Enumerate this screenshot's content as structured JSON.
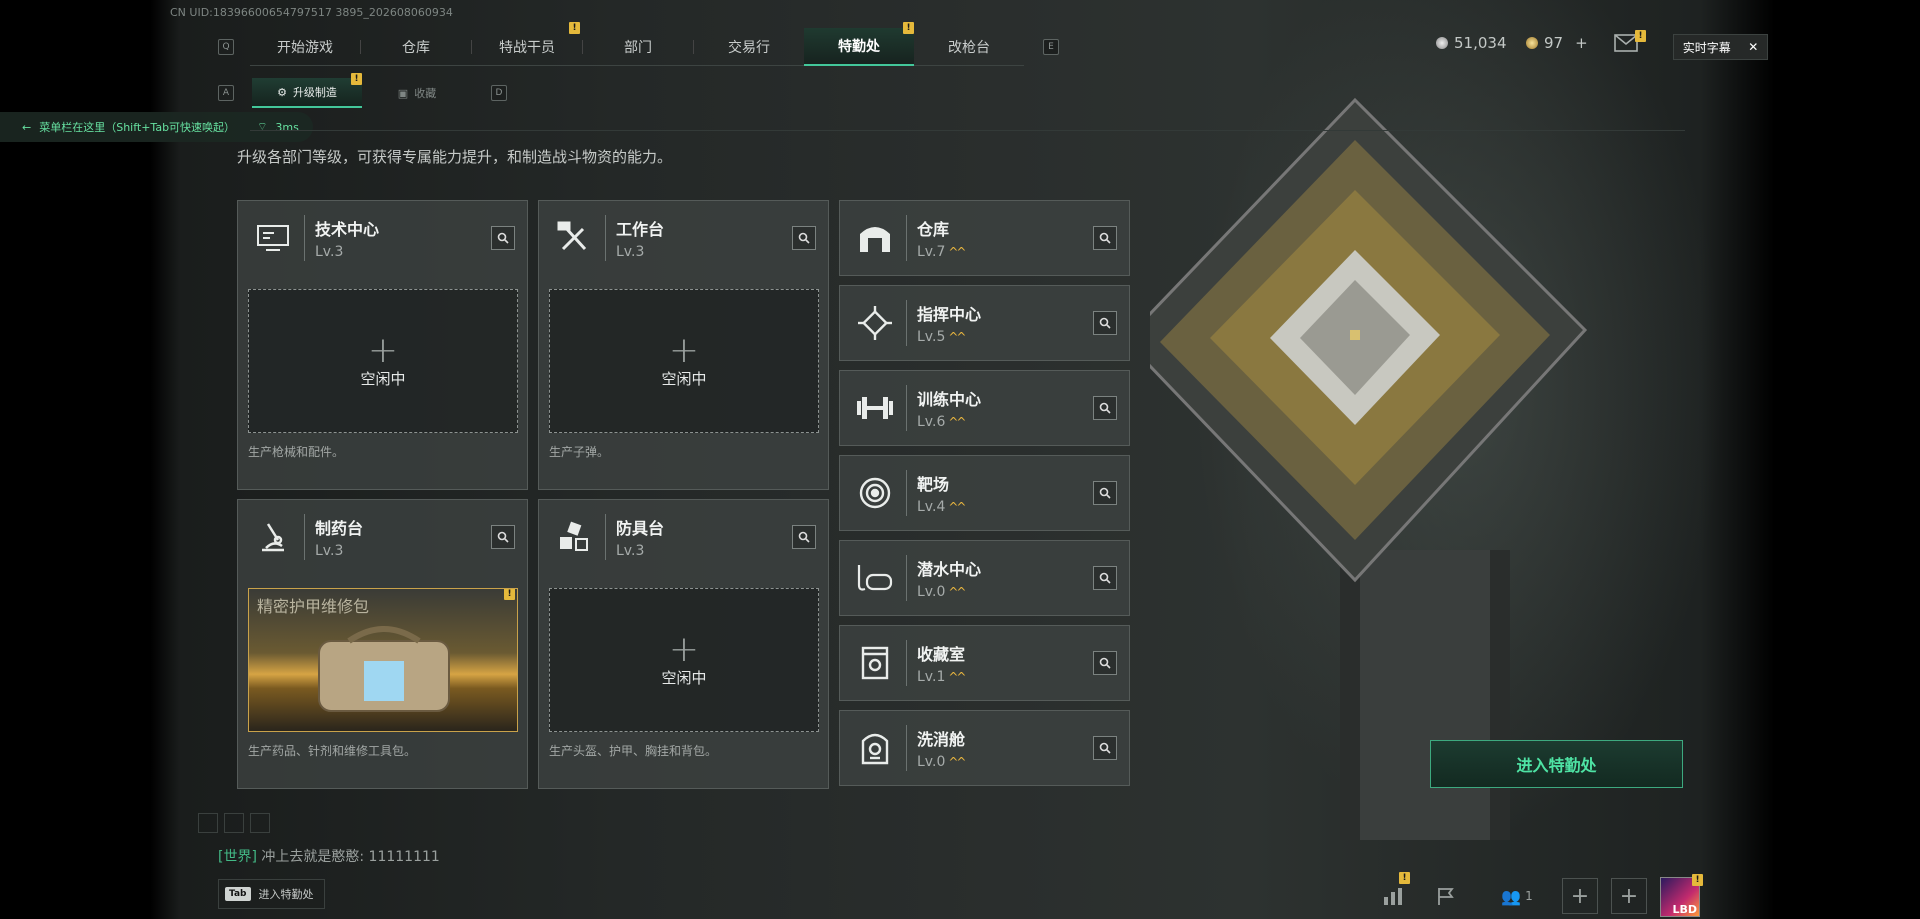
{
  "uid": "CN UID:18396600654797517 3895_202608060934",
  "nav": {
    "left_key": "Q",
    "right_key": "E",
    "tabs": [
      {
        "label": "开始游戏",
        "active": false,
        "badge": ""
      },
      {
        "label": "仓库",
        "active": false,
        "badge": ""
      },
      {
        "label": "特战干员",
        "active": false,
        "badge": "!"
      },
      {
        "label": "部门",
        "active": false,
        "badge": ""
      },
      {
        "label": "交易行",
        "active": false,
        "badge": ""
      },
      {
        "label": "特勤处",
        "active": true,
        "badge": "!"
      },
      {
        "label": "改枪台",
        "active": false,
        "badge": ""
      }
    ]
  },
  "subnav": {
    "left_key": "A",
    "right_key": "D",
    "tabs": [
      {
        "label": "升级制造",
        "active": true,
        "badge": "!"
      },
      {
        "label": "收藏",
        "active": false,
        "badge": ""
      }
    ]
  },
  "hint": {
    "text": "菜单栏在这里（Shift+Tab可快速唤起）",
    "ping": "3ms"
  },
  "description": "升级各部门等级，可获得专属能力提升，和制造战斗物资的能力。",
  "production": [
    {
      "name": "技术中心",
      "level": "Lv.3",
      "icon": "computer-icon",
      "status": "空闲中",
      "item": "",
      "desc": "生产枪械和配件。"
    },
    {
      "name": "工作台",
      "level": "Lv.3",
      "icon": "tools-icon",
      "status": "空闲中",
      "item": "",
      "desc": "生产子弹。"
    },
    {
      "name": "制药台",
      "level": "Lv.3",
      "icon": "microscope-icon",
      "status": "",
      "item": "精密护甲维修包",
      "desc": "生产药品、针剂和维修工具包。"
    },
    {
      "name": "防具台",
      "level": "Lv.3",
      "icon": "cubes-icon",
      "status": "空闲中",
      "item": "",
      "desc": "生产头盔、护甲、胸挂和背包。"
    }
  ],
  "facilities": [
    {
      "name": "仓库",
      "level": "Lv.7",
      "icon": "warehouse-icon",
      "upgrade": "^^"
    },
    {
      "name": "指挥中心",
      "level": "Lv.5",
      "icon": "chip-icon",
      "upgrade": "^^"
    },
    {
      "name": "训练中心",
      "level": "Lv.6",
      "icon": "dumbbell-icon",
      "upgrade": "^^"
    },
    {
      "name": "靶场",
      "level": "Lv.4",
      "icon": "target-icon",
      "upgrade": "^^"
    },
    {
      "name": "潜水中心",
      "level": "Lv.0",
      "icon": "diving-mask-icon",
      "upgrade": "^^"
    },
    {
      "name": "收藏室",
      "level": "Lv.1",
      "icon": "collection-icon",
      "upgrade": "^^"
    },
    {
      "name": "洗消舱",
      "level": "Lv.0",
      "icon": "decon-icon",
      "upgrade": "^^"
    }
  ],
  "currency": {
    "silver": "51,034",
    "gold": "97",
    "gold_add": "+"
  },
  "captions": {
    "label": "实时字幕",
    "close": "✕"
  },
  "enter_button": "进入特勤处",
  "chat": {
    "channel": "[世界]",
    "message": "冲上去就是憨憨: 11111111"
  },
  "tab_hint": {
    "key": "Tab",
    "label": "进入特勤处"
  },
  "bottom": {
    "friends_count": "1",
    "avatar_text": "LBD"
  },
  "colors": {
    "accent": "#43c79a",
    "badge": "#e5b93b",
    "upgrade": "#e8b53f"
  }
}
